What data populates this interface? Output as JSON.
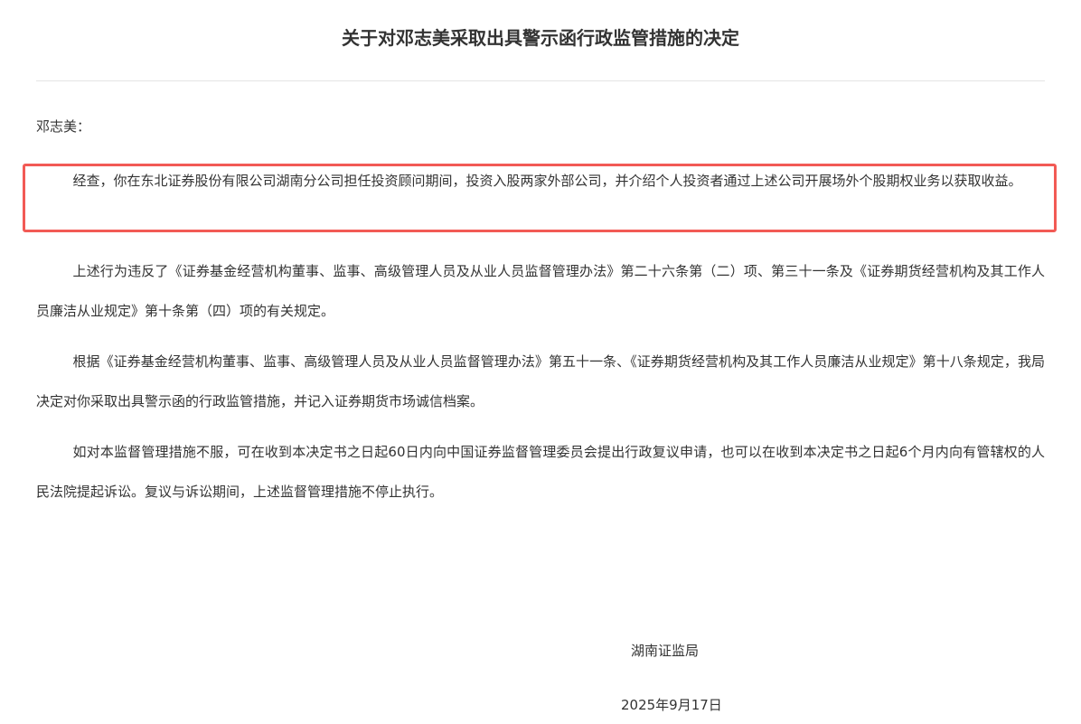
{
  "document": {
    "title": "关于对邓志美采取出具警示函行政监管措施的决定",
    "salutation": "邓志美：",
    "paragraphs": [
      "经查，你在东北证券股份有限公司湖南分公司担任投资顾问期间，投资入股两家外部公司，并介绍个人投资者通过上述公司开展场外个股期权业务以获取收益。",
      "上述行为违反了《证券基金经营机构董事、监事、高级管理人员及从业人员监督管理办法》第二十六条第（二）项、第三十一条及《证券期货经营机构及其工作人员廉洁从业规定》第十条第（四）项的有关规定。",
      "根据《证券基金经营机构董事、监事、高级管理人员及从业人员监督管理办法》第五十一条、《证券期货经营机构及其工作人员廉洁从业规定》第十八条规定，我局决定对你采取出具警示函的行政监管措施，并记入证券期货市场诚信档案。",
      "如对本监督管理措施不服，可在收到本决定书之日起60日内向中国证券监督管理委员会提出行政复议申请，也可以在收到本决定书之日起6个月内向有管辖权的人民法院提起诉讼。复议与诉讼期间，上述监督管理措施不停止执行。"
    ],
    "signer": "湖南证监局",
    "date": "2025年9月17日"
  },
  "colors": {
    "text": "#333333",
    "divider": "#e4e4e4",
    "highlight_border": "#f25a55"
  }
}
